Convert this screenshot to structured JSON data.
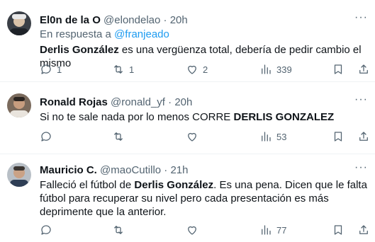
{
  "tweets": [
    {
      "name": "El0n de la O",
      "handle": "@elondelao",
      "sep": "·",
      "time": "20h",
      "reply_prefix": "En respuesta a ",
      "reply_to": "@franjeado",
      "text_bold1": "Derlis González",
      "text_rest1": " es una vergüenza total, debería de pedir cambio el mismo",
      "replies": "1",
      "retweets": "1",
      "likes": "2",
      "views": "339"
    },
    {
      "name": "Ronald Rojas",
      "handle": "@ronald_yf",
      "sep": "·",
      "time": "20h",
      "text_pre": "Si no te sale nada por lo menos CORRE ",
      "text_bold": "DERLIS GONZALEZ",
      "views": "53"
    },
    {
      "name": "Mauricio C.",
      "handle": "@maoCutillo",
      "sep": "·",
      "time": "21h",
      "text_pre": "Falleció el fútbol de ",
      "text_bold": "Derlis González",
      "text_post": ". Es una pena. Dicen que le falta fútbol para recuperar su nivel pero cada presentación es más deprimente que la anterior.",
      "views": "77"
    }
  ],
  "icons": {
    "reply": "comment-icon",
    "retweet": "retweet-icon",
    "like": "heart-icon",
    "views": "views-icon",
    "bookmark": "bookmark-icon",
    "share": "share-icon",
    "more": "more-icon"
  },
  "colors": {
    "link": "#1d9bf0",
    "muted": "#536471",
    "text": "#0f1419"
  }
}
